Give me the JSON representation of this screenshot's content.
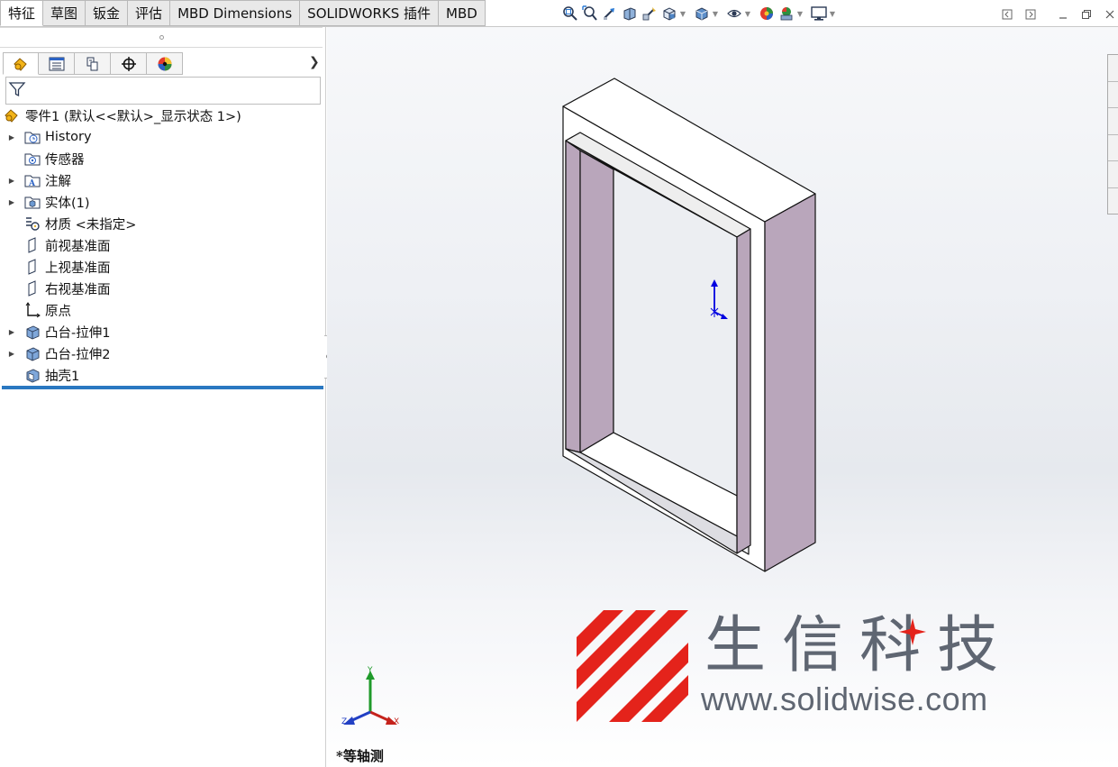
{
  "command_tabs": [
    "特征",
    "草图",
    "钣金",
    "评估",
    "MBD Dimensions",
    "SOLIDWORKS 插件",
    "MBD"
  ],
  "hud_icons": [
    "zoom-to-fit-icon",
    "zoom-to-area-icon",
    "previous-view-icon",
    "section-view-icon",
    "dynamic-annotation-icon",
    "view-orientation-icon",
    "display-style-icon",
    "hide-show-items-icon",
    "edit-appearance-icon",
    "apply-scene-icon",
    "view-settings-icon"
  ],
  "window_controls": [
    "restore-left-icon",
    "restore-right-icon",
    "minimize-icon",
    "maximize-icon",
    "close-icon"
  ],
  "feature_manager": {
    "tabs": [
      "featuremanager-tree-icon",
      "propertymanager-icon",
      "configurationmanager-icon",
      "dimxpert-icon",
      "displaymanager-icon"
    ],
    "root": "零件1  (默认<<默认>_显示状态 1>)",
    "items": [
      {
        "label": "History",
        "expandable": true,
        "icon": "history-folder-icon"
      },
      {
        "label": "传感器",
        "expandable": false,
        "icon": "sensors-folder-icon"
      },
      {
        "label": "注解",
        "expandable": true,
        "icon": "annotations-folder-icon"
      },
      {
        "label": "实体(1)",
        "expandable": true,
        "icon": "solid-bodies-folder-icon"
      },
      {
        "label": "材质 <未指定>",
        "expandable": false,
        "icon": "material-icon"
      },
      {
        "label": "前视基准面",
        "expandable": false,
        "icon": "plane-icon"
      },
      {
        "label": "上视基准面",
        "expandable": false,
        "icon": "plane-icon"
      },
      {
        "label": "右视基准面",
        "expandable": false,
        "icon": "plane-icon"
      },
      {
        "label": "原点",
        "expandable": false,
        "icon": "origin-icon"
      },
      {
        "label": "凸台-拉伸1",
        "expandable": true,
        "icon": "boss-extrude-icon"
      },
      {
        "label": "凸台-拉伸2",
        "expandable": true,
        "icon": "boss-extrude-icon"
      },
      {
        "label": "抽壳1",
        "expandable": false,
        "icon": "shell-icon"
      }
    ]
  },
  "viewport": {
    "view_label": "*等轴测",
    "triad_labels": {
      "x": "X",
      "y": "Y",
      "z": "Z"
    },
    "colors": {
      "inner_face": "#b9a6bb",
      "face_white": "#ffffff",
      "edge": "#111111",
      "origin_arrow": "#0000e0"
    }
  },
  "watermark": {
    "title": "生信科技",
    "url": "www.solidwise.com",
    "colors": {
      "logo_red": "#e4231b",
      "text_gray": "#5f6672"
    }
  }
}
